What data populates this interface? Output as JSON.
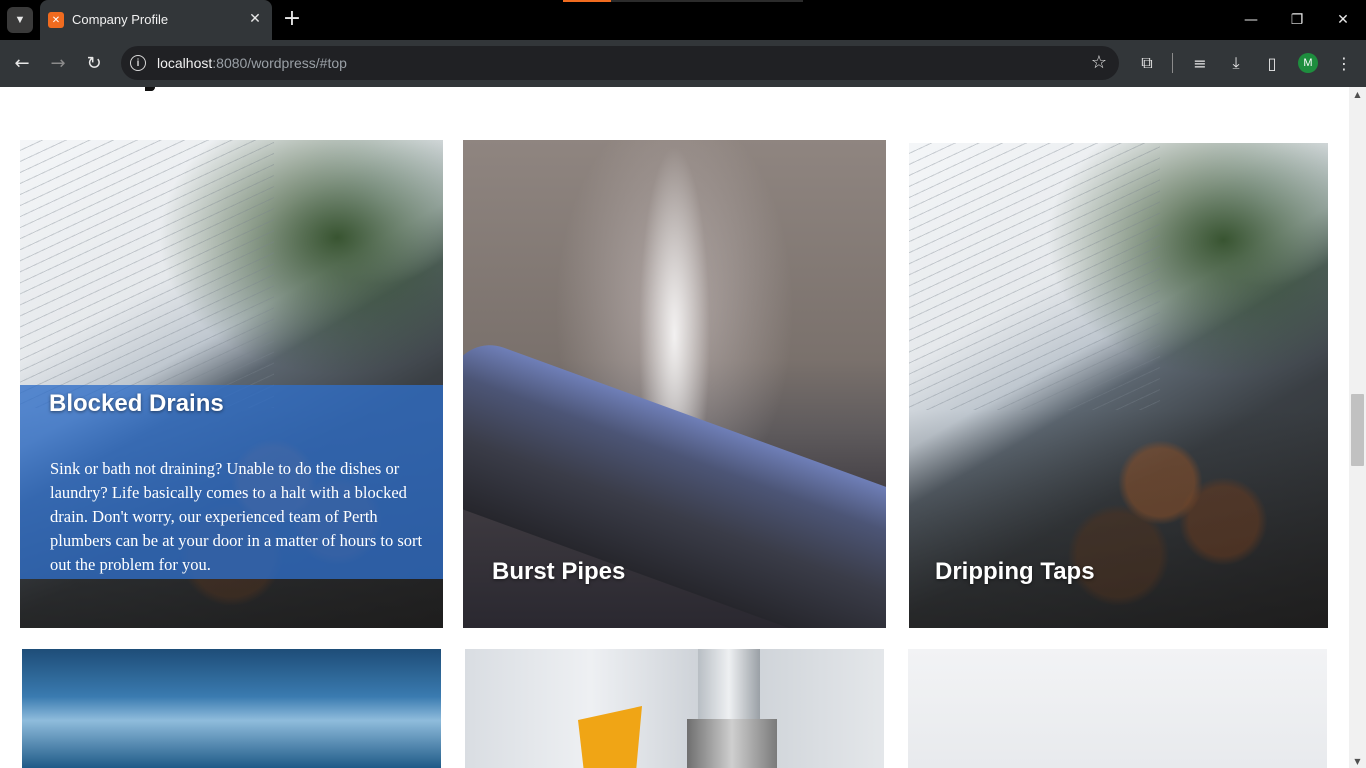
{
  "browser": {
    "tab": {
      "title": "Company Profile",
      "favicon": "xampp-icon"
    },
    "address": {
      "host": "localhost",
      "path": ":8080/wordpress/#top"
    },
    "icons": {
      "tab_search": "chevron-down-icon",
      "tab_close": "close-icon",
      "new_tab": "plus-icon",
      "minimize": "minimize-icon",
      "restore": "restore-icon",
      "close_window": "close-icon",
      "back": "back-arrow-icon",
      "forward": "forward-arrow-icon",
      "reload": "reload-icon",
      "site_info": "info-icon",
      "bookmark": "star-icon",
      "extensions": "puzzle-icon",
      "media": "media-queue-icon",
      "downloads": "download-icon",
      "side_panel": "side-panel-icon",
      "menu": "kebab-menu-icon"
    },
    "profile_initial": "M",
    "accent": "#f06b1f"
  },
  "services": [
    {
      "title": "Blocked Drains",
      "description": "Sink or bath not draining? Unable to do the dishes or laundry? Life basically comes to a halt with a blocked drain. Don't worry, our experienced team of Perth plumbers can be at your door in a matter of hours to sort out the problem for you."
    },
    {
      "title": "Burst Pipes"
    },
    {
      "title": "Dripping Taps"
    }
  ],
  "colors": {
    "overlay": "#2f6ec8"
  }
}
